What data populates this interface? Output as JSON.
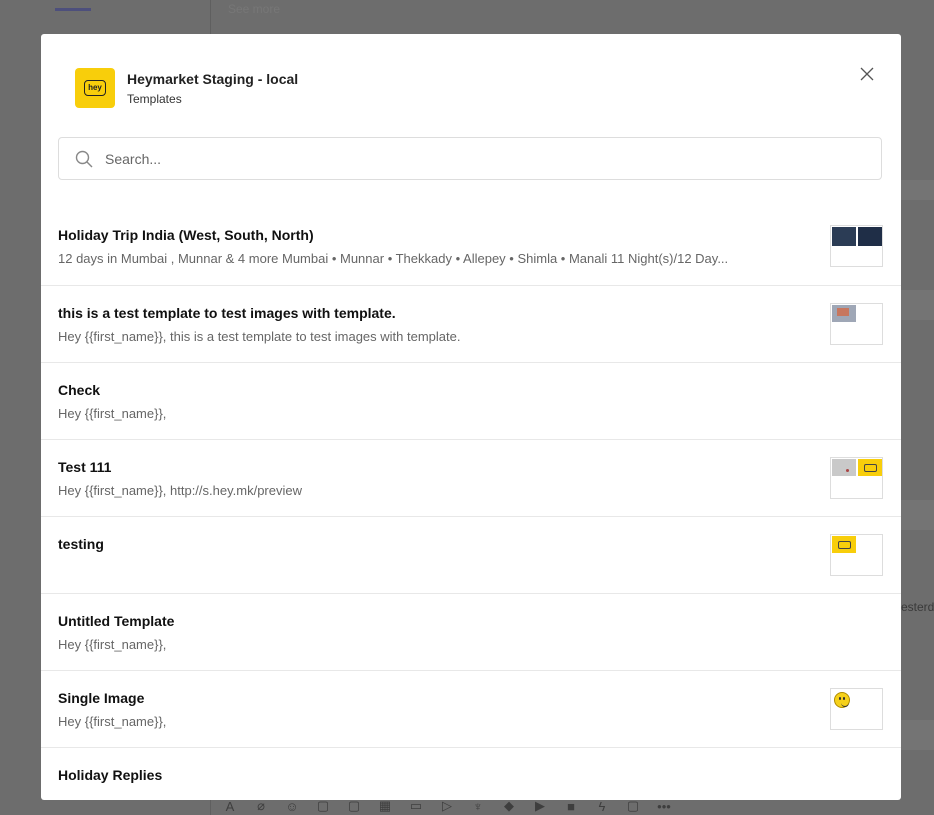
{
  "background": {
    "see_more": "See more",
    "right_text": "esterd"
  },
  "modal": {
    "title": "Heymarket Staging - local",
    "subtitle": "Templates",
    "logo_text": "hey"
  },
  "search": {
    "placeholder": "Search...",
    "value": ""
  },
  "templates": [
    {
      "title": "Holiday Trip India (West, South, North)",
      "body": "12 days in Mumbai , Munnar & 4 more Mumbai • Munnar • Thekkady • Allepey • Shimla • Manali 11 Night(s)/12 Day...",
      "thumbnail": "two-dark-images"
    },
    {
      "title": "this is a test template to test images with template.",
      "body": "Hey {{first_name}}, this is a test template to test images with template.",
      "thumbnail": "photo-image"
    },
    {
      "title": "Check",
      "body": "Hey {{first_name}},",
      "thumbnail": ""
    },
    {
      "title": "Test 111",
      "body": "Hey {{first_name}}, http://s.hey.mk/preview",
      "thumbnail": "grey-and-hey-logo"
    },
    {
      "title": "testing",
      "body": "",
      "thumbnail": "hey-logo"
    },
    {
      "title": "Untitled Template",
      "body": "Hey {{first_name}},",
      "thumbnail": ""
    },
    {
      "title": "Single Image",
      "body": "Hey {{first_name}},",
      "thumbnail": "smiley-emoji"
    },
    {
      "title": "Holiday Replies",
      "body": "",
      "thumbnail": ""
    }
  ],
  "colors": {
    "brand_yellow": "#f8ce0b",
    "overlay": "#6d6d6d"
  }
}
